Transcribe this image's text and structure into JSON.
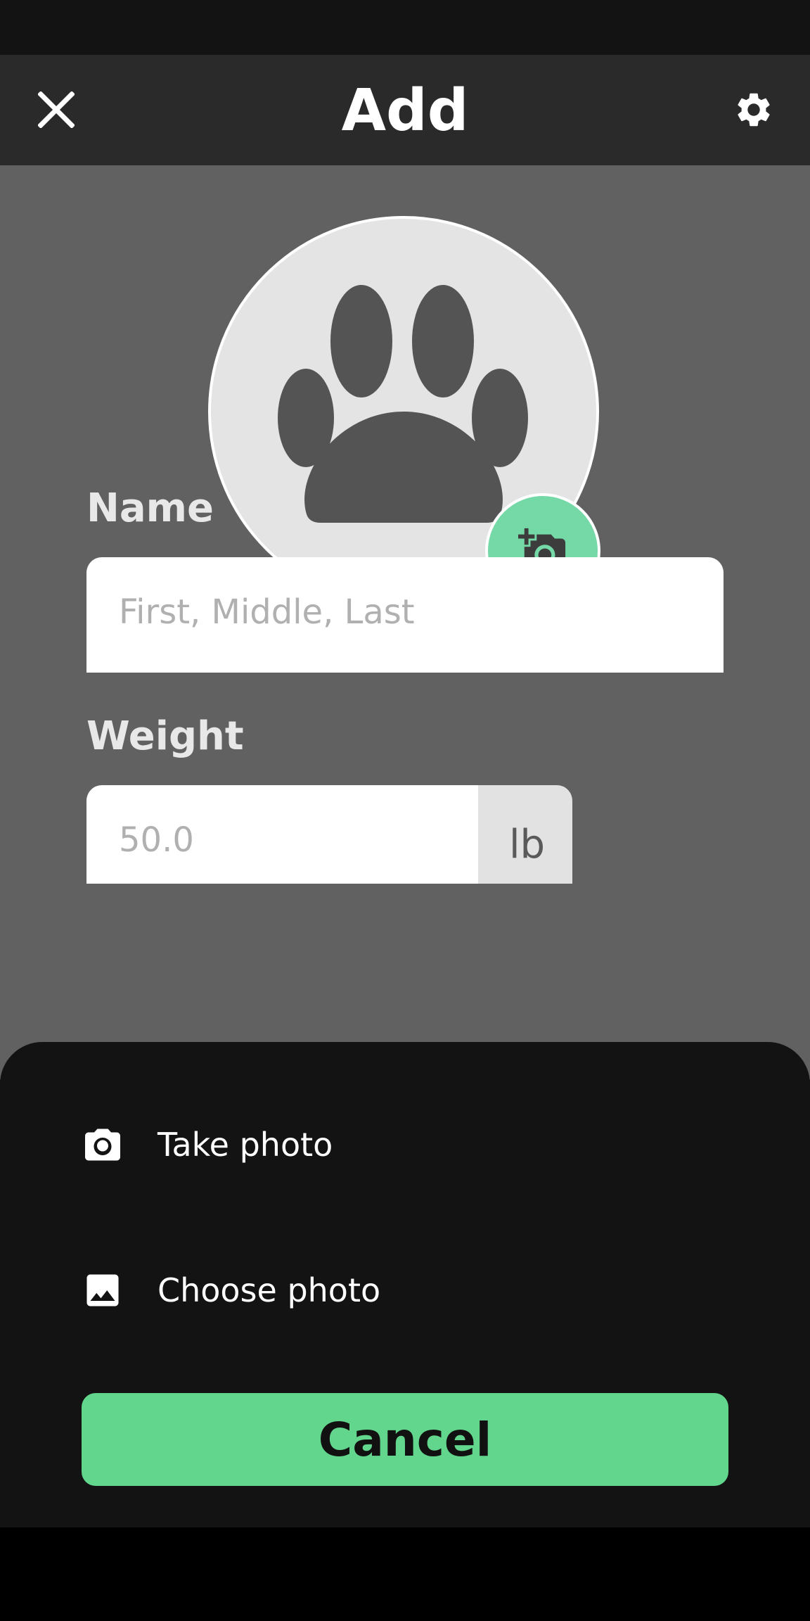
{
  "header": {
    "title": "Add",
    "close_icon": "close-icon",
    "settings_icon": "gear-icon"
  },
  "avatar": {
    "placeholder_icon": "paw-icon",
    "add_photo_icon": "add-camera-icon"
  },
  "form": {
    "name_label": "Name",
    "name_placeholder": "First, Middle, Last",
    "weight_label": "Weight",
    "weight_placeholder": "50.0",
    "weight_unit": "lb"
  },
  "sheet": {
    "take_photo_label": "Take photo",
    "take_photo_icon": "camera-icon",
    "choose_photo_label": "Choose photo",
    "choose_photo_icon": "image-icon",
    "cancel_label": "Cancel"
  },
  "colors": {
    "accent": "#62d68d",
    "avatar_button": "#74d9a6",
    "app_bar": "#2a2a2a",
    "sheet": "#131313"
  }
}
